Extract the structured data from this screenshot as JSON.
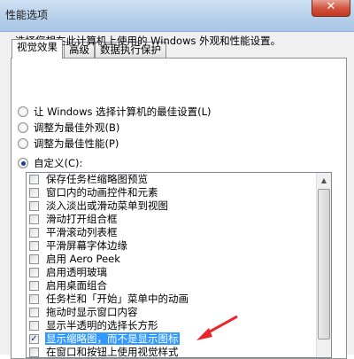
{
  "window": {
    "title": "性能选项",
    "close_glyph": "✕"
  },
  "tabs": [
    {
      "label": "视觉效果",
      "active": true
    },
    {
      "label": "高级",
      "active": false
    },
    {
      "label": "数据执行保护",
      "active": false
    }
  ],
  "description": "选择您想在此计算机上使用的 Windows 外观和性能设置。",
  "radios": [
    {
      "label": "让 Windows 选择计算机的最佳设置(L)",
      "checked": false
    },
    {
      "label": "调整为最佳外观(B)",
      "checked": false
    },
    {
      "label": "调整为最佳性能(P)",
      "checked": false
    },
    {
      "label": "自定义(C):",
      "checked": true
    }
  ],
  "effects": [
    {
      "label": "保存任务栏缩略图预览",
      "checked": false
    },
    {
      "label": "窗口内的动画控件和元素",
      "checked": false
    },
    {
      "label": "淡入淡出或滑动菜单到视图",
      "checked": false
    },
    {
      "label": "滑动打开组合框",
      "checked": false
    },
    {
      "label": "平滑滚动列表框",
      "checked": false
    },
    {
      "label": "平滑屏幕字体边缘",
      "checked": false
    },
    {
      "label": "启用 Aero Peek",
      "checked": false
    },
    {
      "label": "启用透明玻璃",
      "checked": false
    },
    {
      "label": "启用桌面组合",
      "checked": false
    },
    {
      "label": "任务栏和「开始」菜单中的动画",
      "checked": false
    },
    {
      "label": "拖动时显示窗口内容",
      "checked": false
    },
    {
      "label": "显示半透明的选择长方形",
      "checked": false
    },
    {
      "label": "显示缩略图，而不是显示图标",
      "checked": true,
      "selected": true
    },
    {
      "label": "在窗口和按钮上使用视觉样式",
      "checked": false
    }
  ],
  "annotation_color": "#e8262b",
  "selection_color": "#3399ff"
}
